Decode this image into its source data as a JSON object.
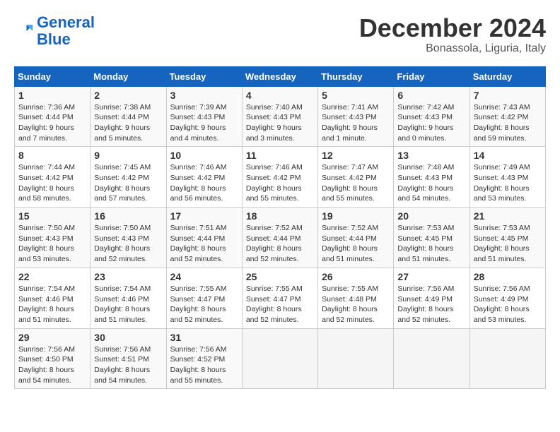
{
  "logo": {
    "line1": "General",
    "line2": "Blue"
  },
  "header": {
    "month": "December 2024",
    "location": "Bonassola, Liguria, Italy"
  },
  "columns": [
    "Sunday",
    "Monday",
    "Tuesday",
    "Wednesday",
    "Thursday",
    "Friday",
    "Saturday"
  ],
  "weeks": [
    [
      {
        "day": "1",
        "info": "Sunrise: 7:36 AM\nSunset: 4:44 PM\nDaylight: 9 hours and 7 minutes."
      },
      {
        "day": "2",
        "info": "Sunrise: 7:38 AM\nSunset: 4:44 PM\nDaylight: 9 hours and 5 minutes."
      },
      {
        "day": "3",
        "info": "Sunrise: 7:39 AM\nSunset: 4:43 PM\nDaylight: 9 hours and 4 minutes."
      },
      {
        "day": "4",
        "info": "Sunrise: 7:40 AM\nSunset: 4:43 PM\nDaylight: 9 hours and 3 minutes."
      },
      {
        "day": "5",
        "info": "Sunrise: 7:41 AM\nSunset: 4:43 PM\nDaylight: 9 hours and 1 minute."
      },
      {
        "day": "6",
        "info": "Sunrise: 7:42 AM\nSunset: 4:43 PM\nDaylight: 9 hours and 0 minutes."
      },
      {
        "day": "7",
        "info": "Sunrise: 7:43 AM\nSunset: 4:42 PM\nDaylight: 8 hours and 59 minutes."
      }
    ],
    [
      {
        "day": "8",
        "info": "Sunrise: 7:44 AM\nSunset: 4:42 PM\nDaylight: 8 hours and 58 minutes."
      },
      {
        "day": "9",
        "info": "Sunrise: 7:45 AM\nSunset: 4:42 PM\nDaylight: 8 hours and 57 minutes."
      },
      {
        "day": "10",
        "info": "Sunrise: 7:46 AM\nSunset: 4:42 PM\nDaylight: 8 hours and 56 minutes."
      },
      {
        "day": "11",
        "info": "Sunrise: 7:46 AM\nSunset: 4:42 PM\nDaylight: 8 hours and 55 minutes."
      },
      {
        "day": "12",
        "info": "Sunrise: 7:47 AM\nSunset: 4:42 PM\nDaylight: 8 hours and 55 minutes."
      },
      {
        "day": "13",
        "info": "Sunrise: 7:48 AM\nSunset: 4:43 PM\nDaylight: 8 hours and 54 minutes."
      },
      {
        "day": "14",
        "info": "Sunrise: 7:49 AM\nSunset: 4:43 PM\nDaylight: 8 hours and 53 minutes."
      }
    ],
    [
      {
        "day": "15",
        "info": "Sunrise: 7:50 AM\nSunset: 4:43 PM\nDaylight: 8 hours and 53 minutes."
      },
      {
        "day": "16",
        "info": "Sunrise: 7:50 AM\nSunset: 4:43 PM\nDaylight: 8 hours and 52 minutes."
      },
      {
        "day": "17",
        "info": "Sunrise: 7:51 AM\nSunset: 4:44 PM\nDaylight: 8 hours and 52 minutes."
      },
      {
        "day": "18",
        "info": "Sunrise: 7:52 AM\nSunset: 4:44 PM\nDaylight: 8 hours and 52 minutes."
      },
      {
        "day": "19",
        "info": "Sunrise: 7:52 AM\nSunset: 4:44 PM\nDaylight: 8 hours and 51 minutes."
      },
      {
        "day": "20",
        "info": "Sunrise: 7:53 AM\nSunset: 4:45 PM\nDaylight: 8 hours and 51 minutes."
      },
      {
        "day": "21",
        "info": "Sunrise: 7:53 AM\nSunset: 4:45 PM\nDaylight: 8 hours and 51 minutes."
      }
    ],
    [
      {
        "day": "22",
        "info": "Sunrise: 7:54 AM\nSunset: 4:46 PM\nDaylight: 8 hours and 51 minutes."
      },
      {
        "day": "23",
        "info": "Sunrise: 7:54 AM\nSunset: 4:46 PM\nDaylight: 8 hours and 51 minutes."
      },
      {
        "day": "24",
        "info": "Sunrise: 7:55 AM\nSunset: 4:47 PM\nDaylight: 8 hours and 52 minutes."
      },
      {
        "day": "25",
        "info": "Sunrise: 7:55 AM\nSunset: 4:47 PM\nDaylight: 8 hours and 52 minutes."
      },
      {
        "day": "26",
        "info": "Sunrise: 7:55 AM\nSunset: 4:48 PM\nDaylight: 8 hours and 52 minutes."
      },
      {
        "day": "27",
        "info": "Sunrise: 7:56 AM\nSunset: 4:49 PM\nDaylight: 8 hours and 52 minutes."
      },
      {
        "day": "28",
        "info": "Sunrise: 7:56 AM\nSunset: 4:49 PM\nDaylight: 8 hours and 53 minutes."
      }
    ],
    [
      {
        "day": "29",
        "info": "Sunrise: 7:56 AM\nSunset: 4:50 PM\nDaylight: 8 hours and 54 minutes."
      },
      {
        "day": "30",
        "info": "Sunrise: 7:56 AM\nSunset: 4:51 PM\nDaylight: 8 hours and 54 minutes."
      },
      {
        "day": "31",
        "info": "Sunrise: 7:56 AM\nSunset: 4:52 PM\nDaylight: 8 hours and 55 minutes."
      },
      null,
      null,
      null,
      null
    ]
  ]
}
